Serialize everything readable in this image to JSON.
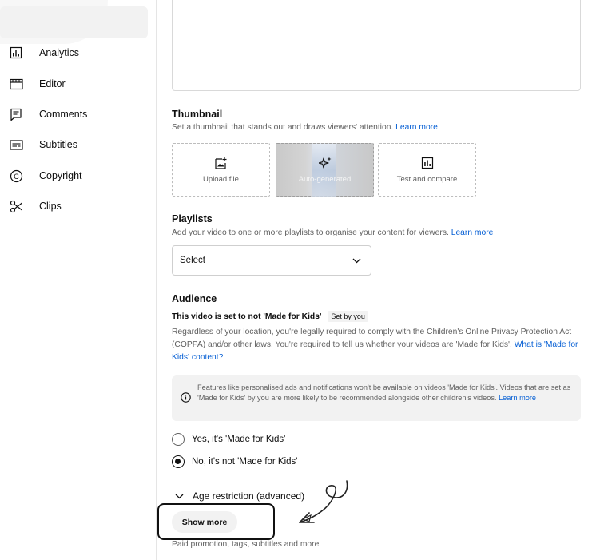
{
  "sidebar": {
    "items": [
      {
        "label": "Analytics",
        "icon": "analytics-icon"
      },
      {
        "label": "Editor",
        "icon": "editor-icon"
      },
      {
        "label": "Comments",
        "icon": "comments-icon"
      },
      {
        "label": "Subtitles",
        "icon": "subtitles-icon"
      },
      {
        "label": "Copyright",
        "icon": "copyright-icon"
      },
      {
        "label": "Clips",
        "icon": "clips-icon"
      }
    ]
  },
  "thumbnail": {
    "title": "Thumbnail",
    "subtitle": "Set a thumbnail that stands out and draws viewers' attention.",
    "learn_more": "Learn more",
    "options": [
      {
        "label": "Upload file",
        "icon": "upload-image-icon"
      },
      {
        "label": "Auto-generated",
        "icon": "sparkle-icon"
      },
      {
        "label": "Test and compare",
        "icon": "chart-icon"
      }
    ]
  },
  "playlists": {
    "title": "Playlists",
    "subtitle": "Add your video to one or more playlists to organise your content for viewers.",
    "learn_more": "Learn more",
    "select_value": "Select"
  },
  "audience": {
    "title": "Audience",
    "status": "This video is set to not 'Made for Kids'",
    "badge": "Set by you",
    "description": "Regardless of your location, you're legally required to comply with the Children's Online Privacy Protection Act (COPPA) and/or other laws. You're required to tell us whether your videos are 'Made for Kids'.",
    "description_link": "What is 'Made for Kids' content?",
    "info_text": "Features like personalised ads and notifications won't be available on videos 'Made for Kids'. Videos that are set as 'Made for Kids' by you are more likely to be recommended alongside other children's videos.",
    "info_link": "Learn more",
    "option_yes": "Yes, it's 'Made for Kids'",
    "option_no": "No, it's not 'Made for Kids'"
  },
  "age_restriction": {
    "label": "Age restriction (advanced)"
  },
  "show_more": {
    "label": "Show more",
    "caption": "Paid promotion, tags, subtitles and more"
  },
  "colors": {
    "link": "#065fd4",
    "text": "#0f0f0f",
    "secondary_text": "#606060",
    "chip_bg": "#f2f2f2"
  }
}
